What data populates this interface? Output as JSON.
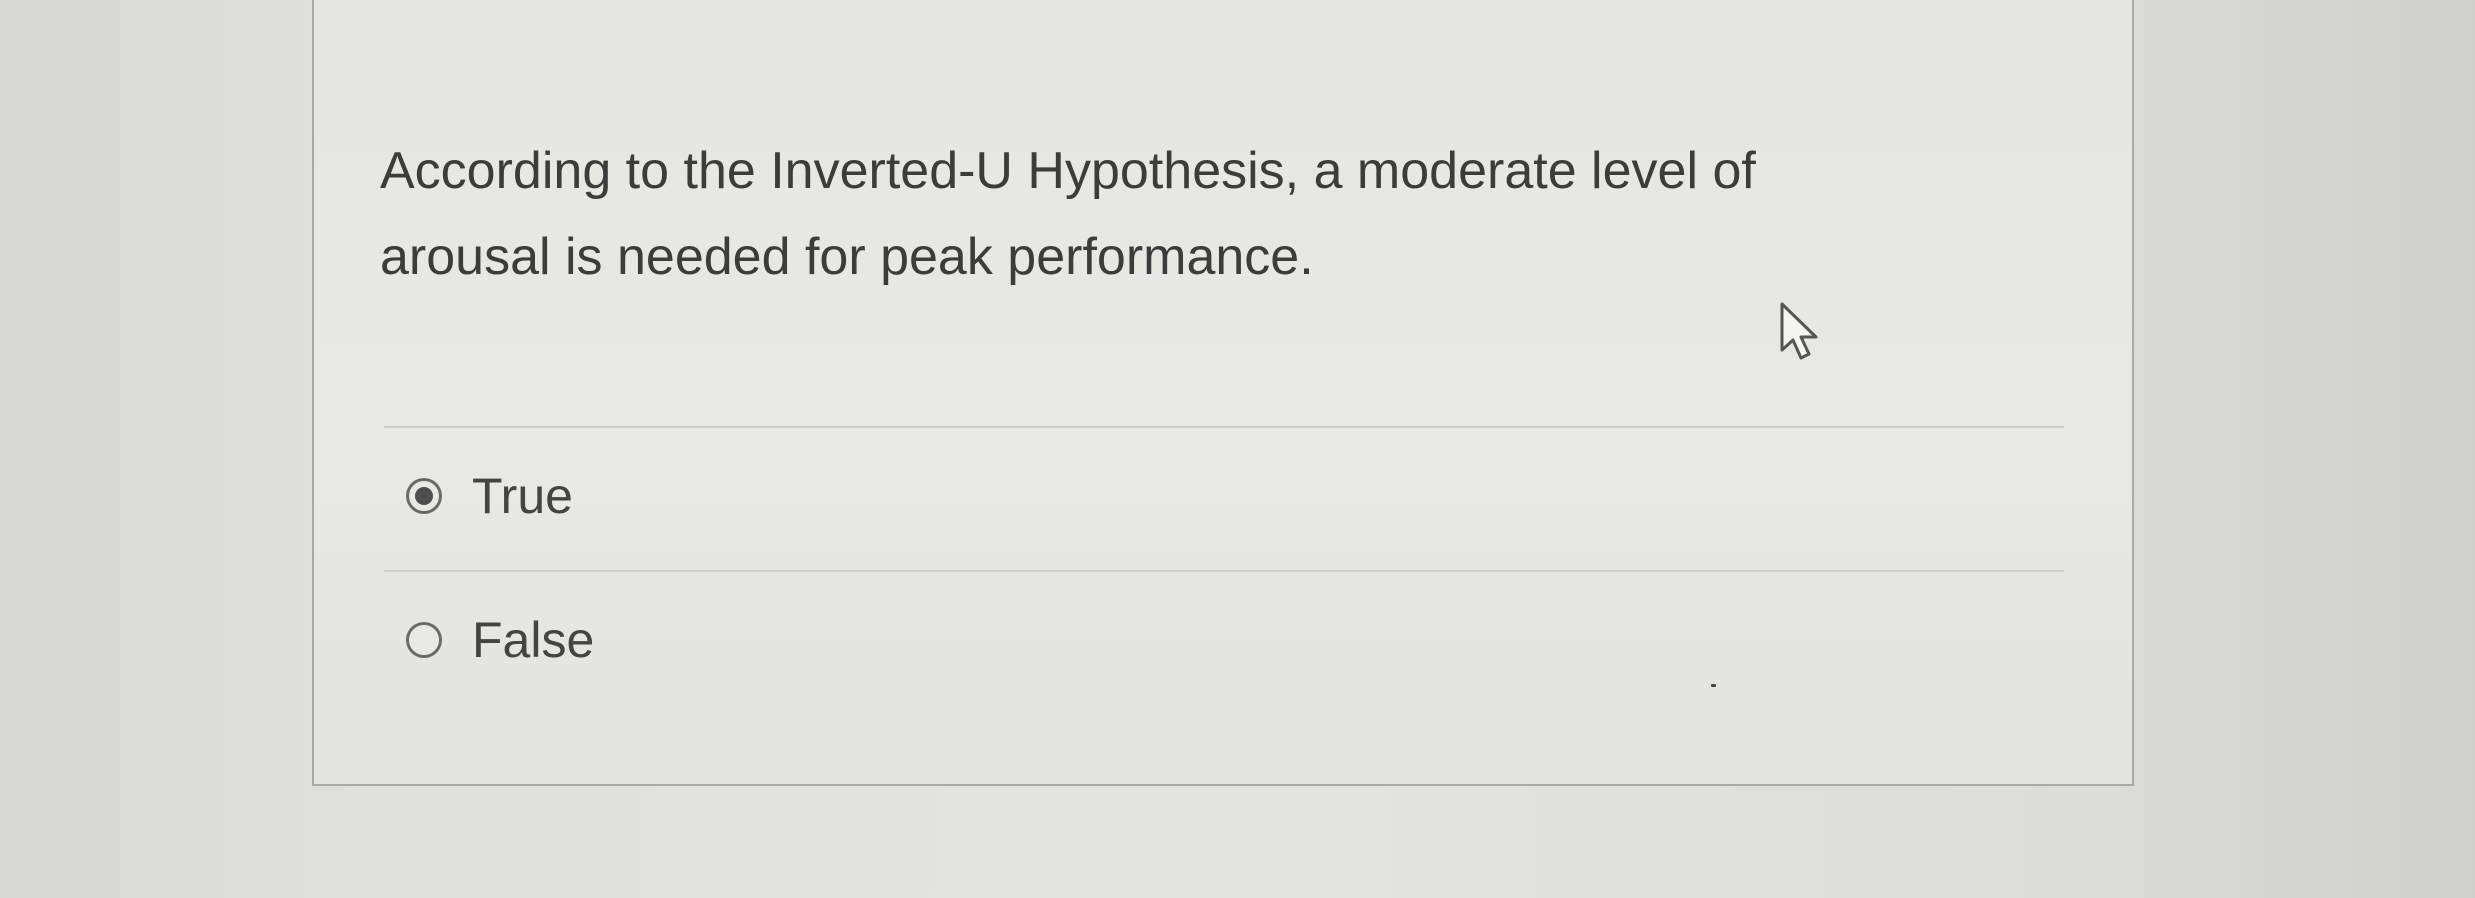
{
  "question": {
    "text": "According to the Inverted-U Hypothesis, a moderate level of arousal is needed for peak performance."
  },
  "options": [
    {
      "label": "True",
      "selected": true
    },
    {
      "label": "False",
      "selected": false
    }
  ],
  "pointer": {
    "icon": "mouse-pointer-icon"
  },
  "colors": {
    "background": "#e0e0de",
    "card": "#e7e7e4",
    "text": "#3c3c3c",
    "radio_border": "#6a6a6a"
  }
}
